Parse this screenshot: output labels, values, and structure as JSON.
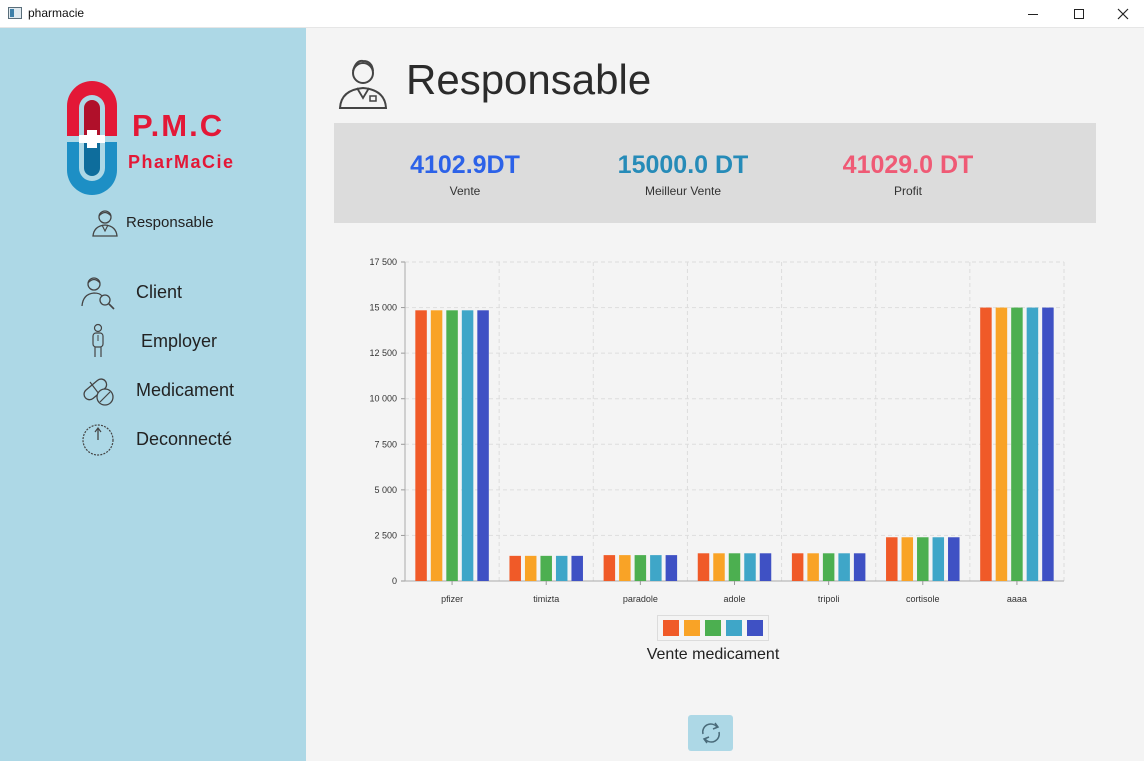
{
  "window": {
    "title": "pharmacie",
    "minimize_icon": "minimize-icon",
    "maximize_icon": "maximize-icon",
    "close_icon": "close-icon"
  },
  "sidebar": {
    "logo_title": "P.M.C",
    "logo_subtitle": "PharMaCie",
    "role_label": "Responsable",
    "role_icon": "user-icon",
    "nav": [
      {
        "label": "Client",
        "icon": "client-search-icon"
      },
      {
        "label": "Employer",
        "icon": "employee-icon"
      },
      {
        "label": "Medicament",
        "icon": "pill-icon"
      },
      {
        "label": "Deconnecté",
        "icon": "power-icon"
      }
    ]
  },
  "header": {
    "title": "Responsable",
    "icon": "user-icon"
  },
  "stats": [
    {
      "value": "4102.9DT",
      "label": "Vente",
      "color": "#2c62e8"
    },
    {
      "value": "15000.0 DT",
      "label": "Meilleur Vente",
      "color": "#268bb8"
    },
    {
      "value": "41029.0 DT",
      "label": "Profit",
      "color": "#ef5a75"
    }
  ],
  "chart_data": {
    "type": "bar",
    "title": "Vente medicament",
    "categories": [
      "pfizer",
      "timizta",
      "paradole",
      "adole",
      "tripoli",
      "cortisole",
      "aaaa"
    ],
    "series": [
      {
        "color": "#f05a28",
        "values": [
          14850,
          1380,
          1420,
          1520,
          1520,
          2400,
          15000
        ]
      },
      {
        "color": "#f9a326",
        "values": [
          14850,
          1380,
          1420,
          1520,
          1520,
          2400,
          15000
        ]
      },
      {
        "color": "#4caf50",
        "values": [
          14850,
          1380,
          1420,
          1520,
          1520,
          2400,
          15000
        ]
      },
      {
        "color": "#3fa6c8",
        "values": [
          14850,
          1380,
          1420,
          1520,
          1520,
          2400,
          15000
        ]
      },
      {
        "color": "#3f51c4",
        "values": [
          14850,
          1380,
          1420,
          1520,
          1520,
          2400,
          15000
        ]
      }
    ],
    "ylim": [
      0,
      17500
    ],
    "yticks": [
      0,
      2500,
      5000,
      7500,
      10000,
      12500,
      15000,
      17500
    ],
    "ytick_labels": [
      "0",
      "2 500",
      "5 000",
      "7 500",
      "10 000",
      "12 500",
      "15 000",
      "17 500"
    ],
    "grid": true,
    "legend_position": "bottom"
  },
  "refresh_icon": "refresh-icon",
  "colors": {
    "sidebar": "#add8e6",
    "brand_red": "#e31837",
    "brand_blue": "#1d8fc5"
  }
}
